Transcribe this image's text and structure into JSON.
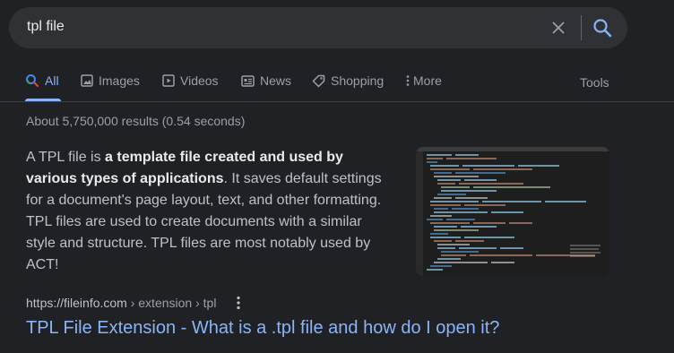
{
  "search": {
    "query": "tpl file"
  },
  "tabs": [
    {
      "label": "All",
      "icon": "search-icon"
    },
    {
      "label": "Images",
      "icon": "image-icon"
    },
    {
      "label": "Videos",
      "icon": "video-icon"
    },
    {
      "label": "News",
      "icon": "news-icon"
    },
    {
      "label": "Shopping",
      "icon": "tag-icon"
    },
    {
      "label": "More",
      "icon": "kebab-icon"
    }
  ],
  "tools_label": "Tools",
  "stats": "About 5,750,000 results (0.54 seconds)",
  "snippet": {
    "part1": "A TPL file is ",
    "bold": "a template file created and used by various types of applications",
    "part2": ". It saves default settings for a document's page layout, text, and other formatting. TPL files are used to create documents with a similar style and structure. TPL files are most notably used by ACT!"
  },
  "result": {
    "domain": "https://fileinfo.com",
    "path": " › extension › tpl",
    "title": "TPL File Extension - What is a .tpl file and how do I open it?"
  },
  "colors": {
    "background": "#202124",
    "searchbar": "#303134",
    "link": "#8ab4f8",
    "text": "#bdc1c6",
    "muted": "#9aa0a6"
  }
}
